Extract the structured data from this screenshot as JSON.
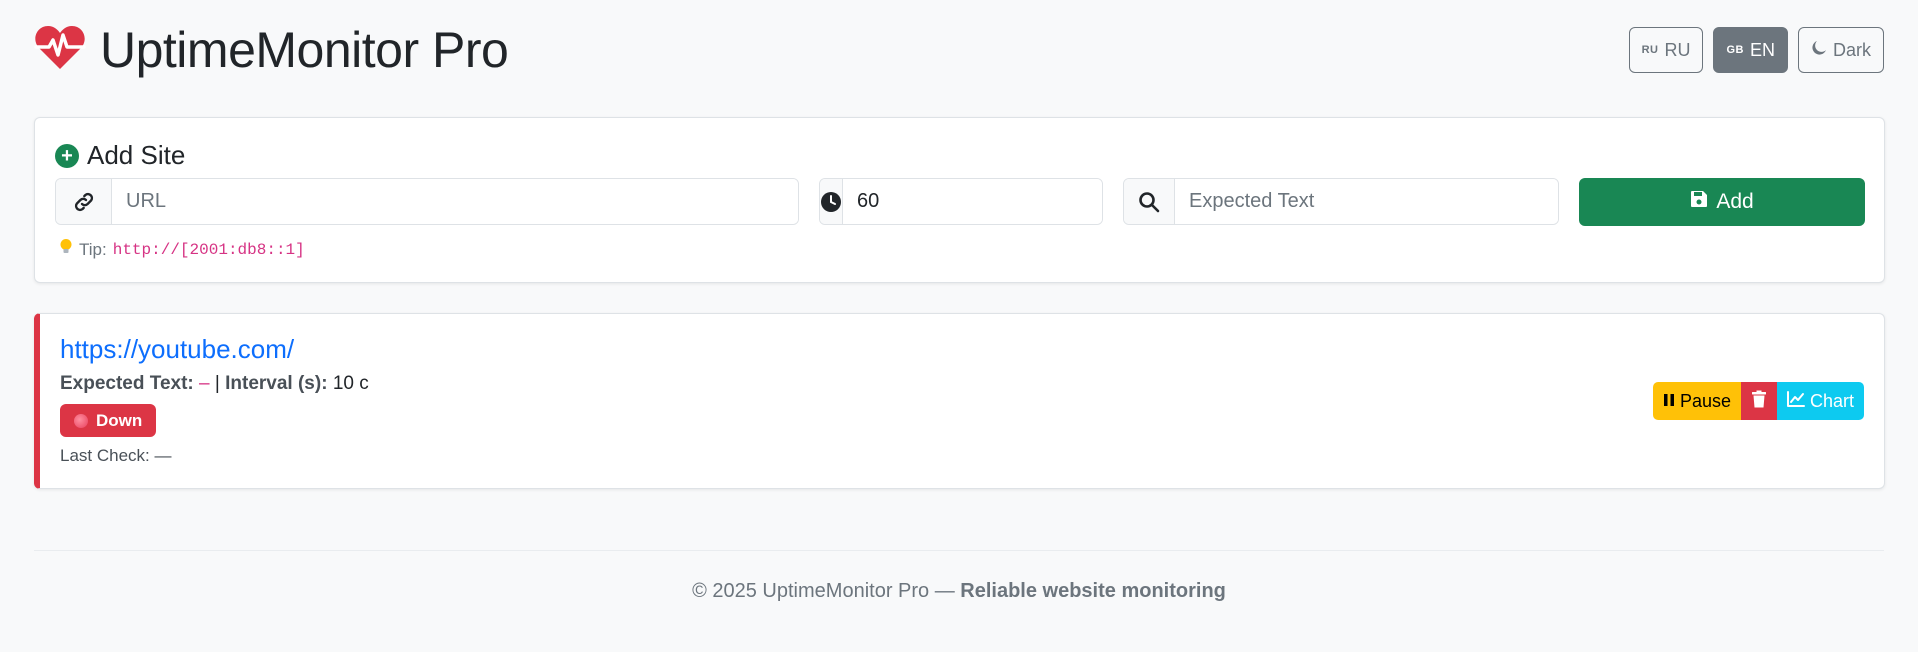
{
  "app": {
    "title": "UptimeMonitor Pro",
    "accent_color": "#dc3545"
  },
  "header": {
    "lang_ru": {
      "flag": "RU",
      "label": "RU"
    },
    "lang_en": {
      "flag": "GB",
      "label": "EN",
      "active": true
    },
    "theme_label": "Dark"
  },
  "add_site": {
    "title": "Add Site",
    "url_placeholder": "URL",
    "interval_value": "60",
    "expected_text_placeholder": "Expected Text",
    "add_button": "Add",
    "tip_label": "Tip:",
    "tip_code": "http://[2001:db8::1]"
  },
  "sites": [
    {
      "url": "https://youtube.com/",
      "expected_text_label": "Expected Text:",
      "expected_text_value": "–",
      "separator": "|",
      "interval_label": "Interval (s):",
      "interval_value": "10 c",
      "status": "Down",
      "status_color": "#dc3545",
      "last_check_label": "Last Check:",
      "last_check_value": "—",
      "actions": {
        "pause": "Pause",
        "chart": "Chart"
      }
    }
  ],
  "footer": {
    "copyright": "© 2025 UptimeMonitor Pro —",
    "tagline": "Reliable website monitoring"
  }
}
